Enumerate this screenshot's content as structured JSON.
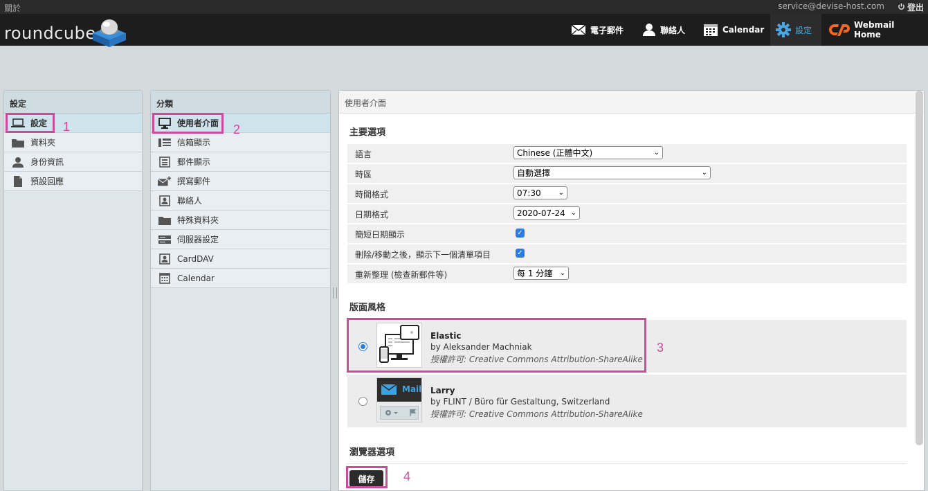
{
  "topbar": {
    "about": "關於",
    "user": "service@devise-host.com",
    "logout": "登出"
  },
  "logo": {
    "text": "roundcube"
  },
  "nav": [
    {
      "label": "電子郵件",
      "icon": "mail-icon"
    },
    {
      "label": "聯絡人",
      "icon": "contacts-icon"
    },
    {
      "label": "Calendar",
      "icon": "calendar-icon"
    },
    {
      "label": "設定",
      "icon": "gear-icon"
    },
    {
      "label": "Webmail Home",
      "icon": "cpanel-icon"
    }
  ],
  "settings_panel": {
    "title": "設定",
    "items": [
      {
        "label": "設定",
        "icon": "laptop-icon"
      },
      {
        "label": "資料夾",
        "icon": "folder-icon"
      },
      {
        "label": "身份資訊",
        "icon": "person-icon"
      },
      {
        "label": "預設回應",
        "icon": "document-icon"
      }
    ]
  },
  "sections_panel": {
    "title": "分類",
    "items": [
      {
        "label": "使用者介面",
        "icon": "monitor-icon"
      },
      {
        "label": "信箱顯示",
        "icon": "mailbox-view-icon"
      },
      {
        "label": "郵件顯示",
        "icon": "message-view-icon"
      },
      {
        "label": "撰寫郵件",
        "icon": "compose-icon"
      },
      {
        "label": "聯絡人",
        "icon": "contact-card-icon"
      },
      {
        "label": "特殊資料夾",
        "icon": "folder-icon"
      },
      {
        "label": "伺服器設定",
        "icon": "server-icon"
      },
      {
        "label": "CardDAV",
        "icon": "contact-card-icon"
      },
      {
        "label": "Calendar",
        "icon": "calendar-icon"
      }
    ]
  },
  "prefs": {
    "title": "使用者介面",
    "main_section": "主要選項",
    "rows": [
      {
        "label": "語言",
        "value": "Chinese (正體中文)",
        "type": "select"
      },
      {
        "label": "時區",
        "value": "自動選擇",
        "type": "select"
      },
      {
        "label": "時間格式",
        "value": "07:30",
        "type": "select"
      },
      {
        "label": "日期格式",
        "value": "2020-07-24",
        "type": "select"
      },
      {
        "label": "簡短日期顯示",
        "value": "checked",
        "type": "checkbox"
      },
      {
        "label": "刪除/移動之後，顯示下一個清單項目",
        "value": "checked",
        "type": "checkbox"
      },
      {
        "label": "重新整理 (檢查新郵件等)",
        "value": "每 1 分鐘",
        "type": "select"
      }
    ],
    "skin_section": "版面風格",
    "skins": [
      {
        "name": "Elastic",
        "author": "by Aleksander Machniak",
        "license": "授權許可: Creative Commons Attribution-ShareAlike",
        "selected": true
      },
      {
        "name": "Larry",
        "author": "by FLINT / Büro für Gestaltung, Switzerland",
        "license": "授權許可: Creative Commons Attribution-ShareAlike",
        "selected": false,
        "thumb_label": "Mail"
      }
    ],
    "browser_section": "瀏覽器選項",
    "save": "儲存"
  },
  "annotations": [
    "1",
    "2",
    "3",
    "4"
  ],
  "colors": {
    "highlight": "#d04a9c",
    "accent": "#4aa7e3",
    "checkbox": "#2c7be5"
  }
}
